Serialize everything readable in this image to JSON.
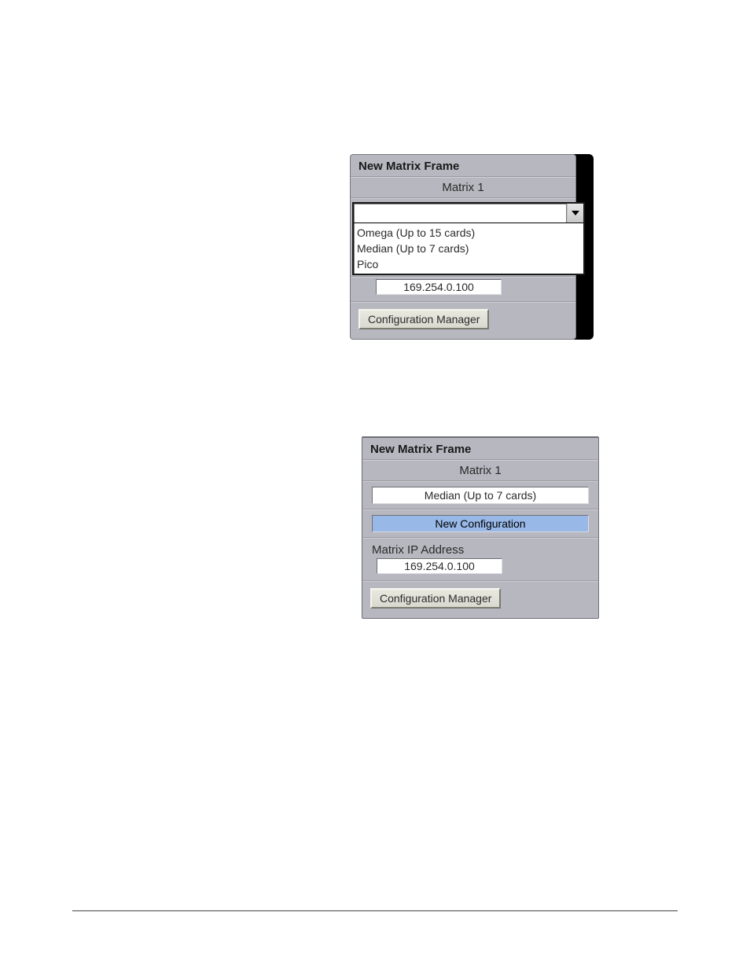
{
  "fig1": {
    "title": "New Matrix Frame",
    "matrix_label": "Matrix 1",
    "dropdown": {
      "selected": "",
      "options": [
        "Omega (Up to 15 cards)",
        "Median (Up to 7 cards)",
        "Pico"
      ]
    },
    "ip_value": "169.254.0.100",
    "config_manager_label": "Configuration Manager"
  },
  "fig2": {
    "title": "New Matrix Frame",
    "matrix_label": "Matrix 1",
    "frame_type_value": "Median (Up to 7 cards)",
    "new_config_label": "New Configuration",
    "ip_label": "Matrix IP Address",
    "ip_value": "169.254.0.100",
    "config_manager_label": "Configuration Manager"
  }
}
